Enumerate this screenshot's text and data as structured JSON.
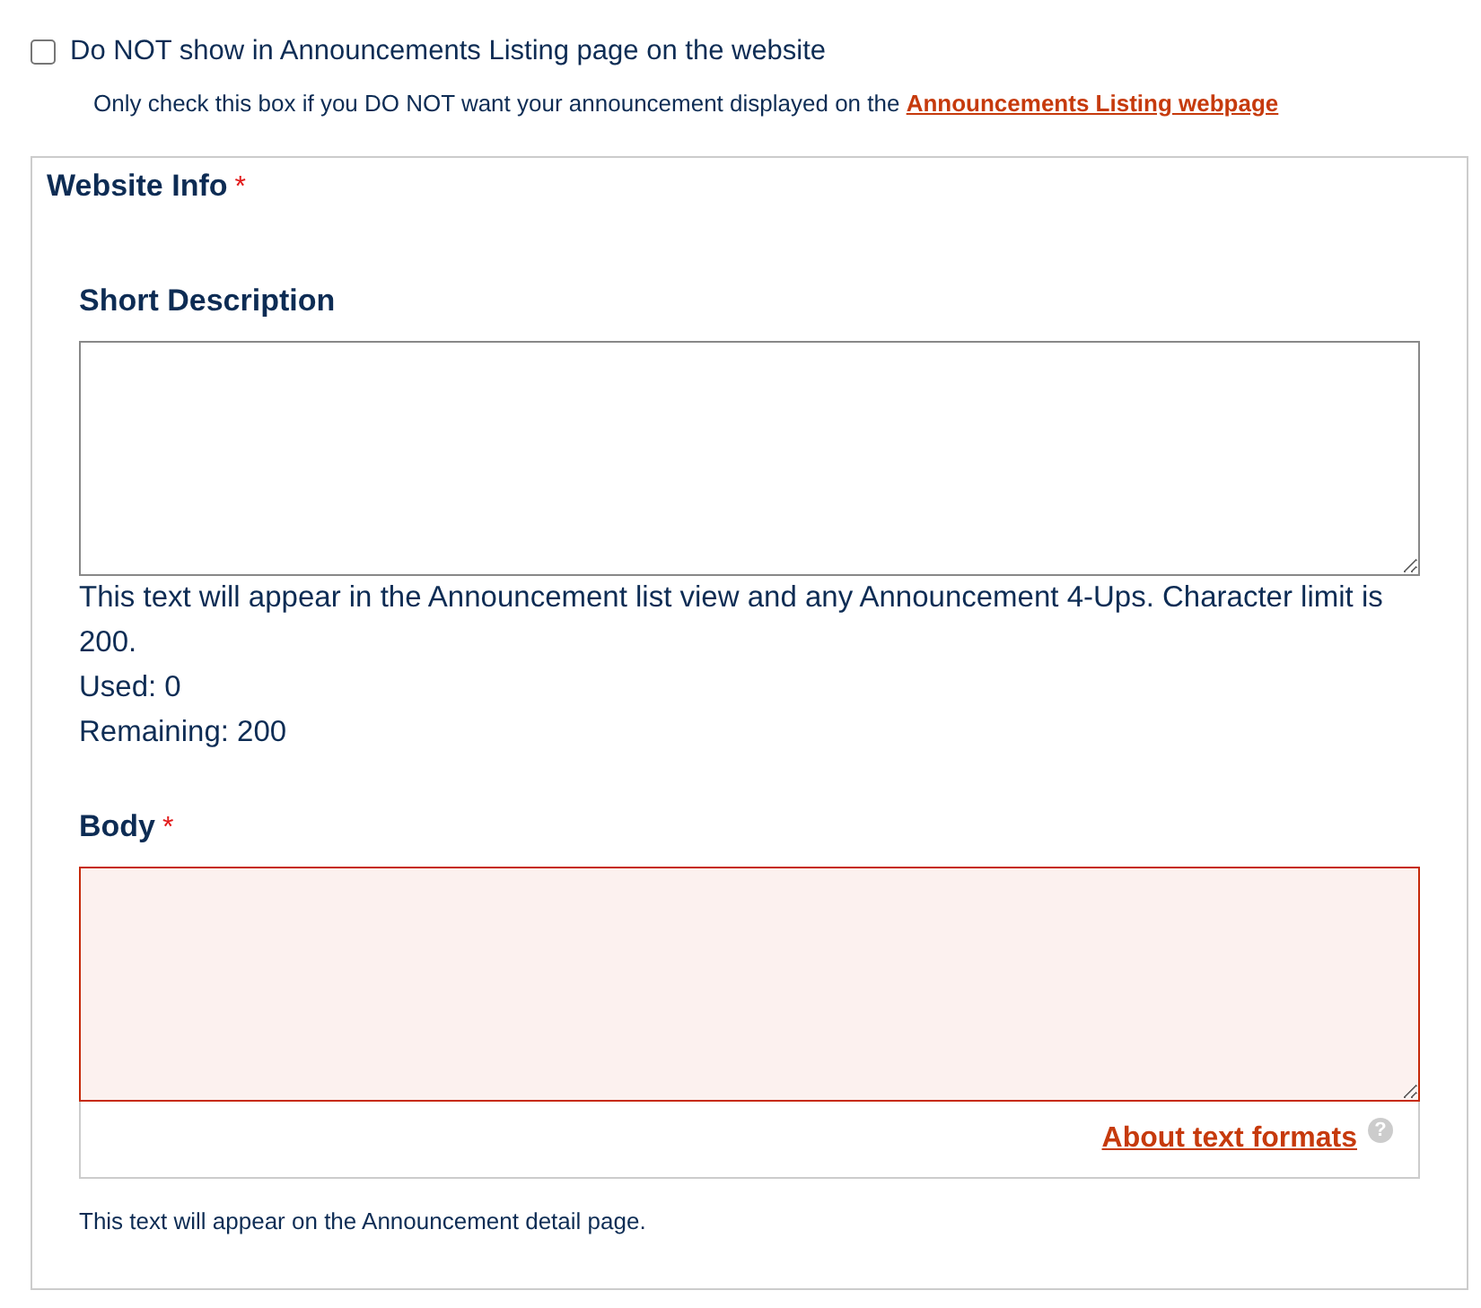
{
  "listing_option": {
    "label": "Do NOT show in Announcements Listing page on the website",
    "checked": false,
    "hint": "Only check this box if you DO NOT want your announcement displayed on the",
    "hint_link": "Announcements Listing webpage"
  },
  "website_info": {
    "legend": "Website Info",
    "required_mark": "*",
    "fields": [
      {
        "label": "Short Description",
        "error": false,
        "help_lines": [
          "This text will appear in the Announcement list view and any Announcement 4-Ups. Character limit is 200.",
          "Used: 0",
          "Remaining: 200"
        ]
      },
      {
        "label": "Body",
        "required_mark": "*",
        "error": true,
        "format_link": "About text formats",
        "format_help_icon": "?",
        "description": "This text will appear on the Announcement detail page."
      }
    ]
  }
}
